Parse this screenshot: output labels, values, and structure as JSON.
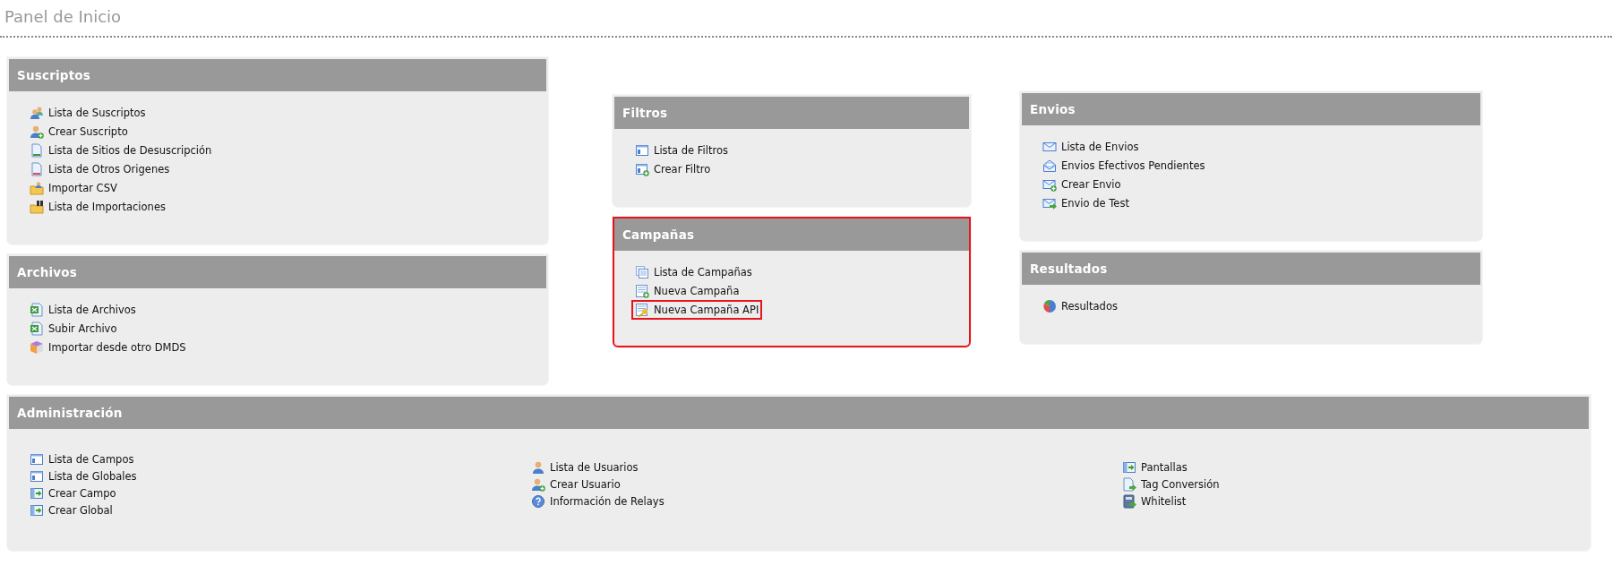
{
  "page": {
    "title": "Panel de Inicio"
  },
  "columns": [
    {
      "panels": [
        {
          "title": "Suscriptos",
          "highlighted": false,
          "items": [
            {
              "label": "Lista de Suscriptos",
              "kind": "users",
              "highlighted": false
            },
            {
              "label": "Crear Suscripto",
              "kind": "user-add",
              "highlighted": false
            },
            {
              "label": "Lista de Sitios de Desuscripción",
              "kind": "doc-green",
              "highlighted": false
            },
            {
              "label": "Lista de Otros Origenes",
              "kind": "doc-red",
              "highlighted": false
            },
            {
              "label": "Importar CSV",
              "kind": "folder-user",
              "highlighted": false
            },
            {
              "label": "Lista de Importaciones",
              "kind": "folder-binoculars",
              "highlighted": false
            }
          ]
        },
        {
          "title": "Archivos",
          "highlighted": false,
          "items": [
            {
              "label": "Lista de Archivos",
              "kind": "spreadsheet",
              "highlighted": false
            },
            {
              "label": "Subir Archivo",
              "kind": "spreadsheet",
              "highlighted": false
            },
            {
              "label": "Importar desde otro DMDS",
              "kind": "cube",
              "highlighted": false
            }
          ]
        }
      ]
    },
    {
      "panels": [
        {
          "title": "Filtros",
          "highlighted": false,
          "items": [
            {
              "label": "Lista de Filtros",
              "kind": "window",
              "highlighted": false
            },
            {
              "label": "Crear Filtro",
              "kind": "window-add",
              "highlighted": false
            }
          ]
        },
        {
          "title": "Campañas",
          "highlighted": true,
          "items": [
            {
              "label": "Lista de Campañas",
              "kind": "pages",
              "highlighted": false
            },
            {
              "label": "Nueva Campaña",
              "kind": "sheet-add",
              "highlighted": false
            },
            {
              "label": "Nueva Campaña API",
              "kind": "sheet-key",
              "highlighted": true
            }
          ]
        }
      ]
    },
    {
      "panels": [
        {
          "title": "Envios",
          "highlighted": false,
          "items": [
            {
              "label": "Lista de Envios",
              "kind": "mail",
              "highlighted": false
            },
            {
              "label": "Envios Efectivos Pendientes",
              "kind": "mail-open",
              "highlighted": false
            },
            {
              "label": "Crear Envio",
              "kind": "mail-add",
              "highlighted": false
            },
            {
              "label": "Envio de Test",
              "kind": "mail-send",
              "highlighted": false
            }
          ]
        },
        {
          "title": "Resultados",
          "highlighted": false,
          "items": [
            {
              "label": "Resultados",
              "kind": "pie",
              "highlighted": false
            }
          ]
        }
      ]
    }
  ],
  "admin": {
    "title": "Administración",
    "highlighted": false,
    "item_columns": [
      {
        "items": [
          {
            "label": "Lista de Campos",
            "kind": "window",
            "highlighted": false
          },
          {
            "label": "Lista de Globales",
            "kind": "window",
            "highlighted": false
          },
          {
            "label": "Crear Campo",
            "kind": "window-arrow",
            "highlighted": false
          },
          {
            "label": "Crear Global",
            "kind": "window-arrow",
            "highlighted": false
          }
        ]
      },
      {
        "items": [
          {
            "label": "Lista de Usuarios",
            "kind": "user",
            "highlighted": false
          },
          {
            "label": "Crear Usuario",
            "kind": "user-add",
            "highlighted": false
          },
          {
            "label": "Información de Relays",
            "kind": "help",
            "highlighted": false
          }
        ]
      },
      {
        "items": [
          {
            "label": "Pantallas",
            "kind": "window-arrow",
            "highlighted": false
          },
          {
            "label": "Tag Conversión",
            "kind": "doc-arrow",
            "highlighted": false
          },
          {
            "label": "Whitelist",
            "kind": "book-arrow",
            "highlighted": false
          }
        ]
      }
    ]
  }
}
